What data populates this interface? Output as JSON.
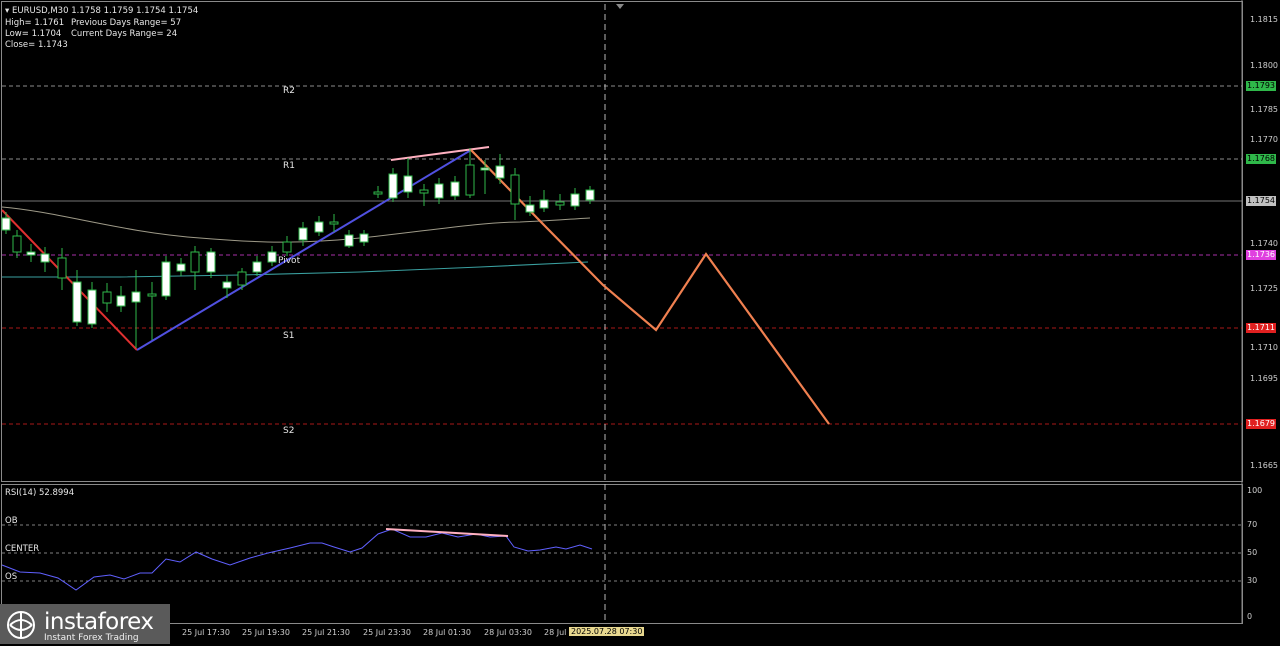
{
  "info": {
    "line1": "EURUSD,M30  1.1758 1.1759 1.1754 1.1754",
    "high": "High= 1.1761",
    "prev_range": "Previous Days Range= 57",
    "low": "Low= 1.1704",
    "curr_range": "Current Days Range= 24",
    "close": "Close= 1.1743"
  },
  "levels": {
    "r2": "R2",
    "r1": "R1",
    "pivot": "Pivot",
    "s1": "S1",
    "s2": "S2"
  },
  "price_axis": [
    "1.1815",
    "1.1800",
    "1.1785",
    "1.1770",
    "1.1740",
    "1.1725",
    "1.1710",
    "1.1695",
    "1.1665"
  ],
  "price_tags": [
    {
      "text": "1.1793",
      "color": "#2fb84a"
    },
    {
      "text": "1.1768",
      "color": "#2fb84a"
    },
    {
      "text": "1.1754",
      "color": "#c0c0c0"
    },
    {
      "text": "1.1736",
      "color": "#e040e0"
    },
    {
      "text": "1.1711",
      "color": "#e02020"
    },
    {
      "text": "1.1679",
      "color": "#e02020"
    }
  ],
  "rsi": {
    "title": "RSI(14) 52.8994",
    "ob": "OB",
    "center": "CENTER",
    "os": "OS",
    "axis": [
      "100",
      "70",
      "50",
      "30",
      "0"
    ]
  },
  "time_axis": [
    "25 Jul 17:30",
    "25 Jul 19:30",
    "25 Jul 21:30",
    "25 Jul 23:30",
    "28 Jul 01:30",
    "28 Jul 03:30",
    "28 Jul",
    "2025.07.28 07:30"
  ],
  "logo": {
    "main": "instaforex",
    "sub": "Instant Forex Trading"
  },
  "colors": {
    "bull": "#2fb84a",
    "pivot_pink": "#e040e0",
    "support_red": "#e02020",
    "forecast": "#f08050",
    "up_trend": "#5050e0",
    "down_trend": "#e03030",
    "rsi_line": "#6060ff",
    "divergence": "#ffb0c0"
  }
}
